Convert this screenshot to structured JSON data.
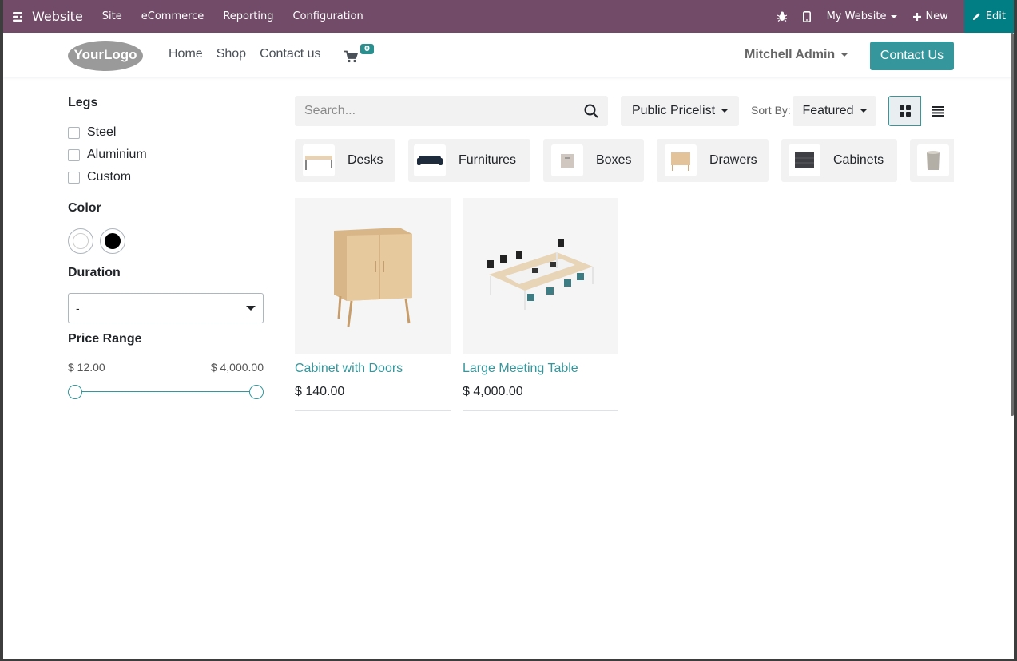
{
  "adminbar": {
    "app_name": "Website",
    "menu": [
      "Site",
      "eCommerce",
      "Reporting",
      "Configuration"
    ],
    "website_selector": "My Website",
    "new_label": "New",
    "edit_label": "Edit",
    "color": "#714b67",
    "edit_color": "#017e84"
  },
  "header": {
    "logo_text": "YourLogo",
    "nav": [
      "Home",
      "Shop",
      "Contact us"
    ],
    "cart_count": "0",
    "user": "Mitchell Admin",
    "contact_button": "Contact Us",
    "accent": "#35979c"
  },
  "filters": {
    "legs_title": "Legs",
    "legs_options": [
      "Steel",
      "Aluminium",
      "Custom"
    ],
    "color_title": "Color",
    "colors": [
      "#ffffff",
      "#000000"
    ],
    "duration_title": "Duration",
    "duration_value": "-",
    "price_title": "Price Range",
    "price_min": "$ 12.00",
    "price_max": "$ 4,000.00"
  },
  "toolbar": {
    "search_placeholder": "Search...",
    "pricelist": "Public Pricelist",
    "sort_label": "Sort By:",
    "sort_value": "Featured",
    "active_view": "grid"
  },
  "categories": [
    "Desks",
    "Furnitures",
    "Boxes",
    "Drawers",
    "Cabinets"
  ],
  "products": [
    {
      "name": "Cabinet with Doors",
      "price": "$ 140.00"
    },
    {
      "name": "Large Meeting Table",
      "price": "$ 4,000.00"
    }
  ]
}
